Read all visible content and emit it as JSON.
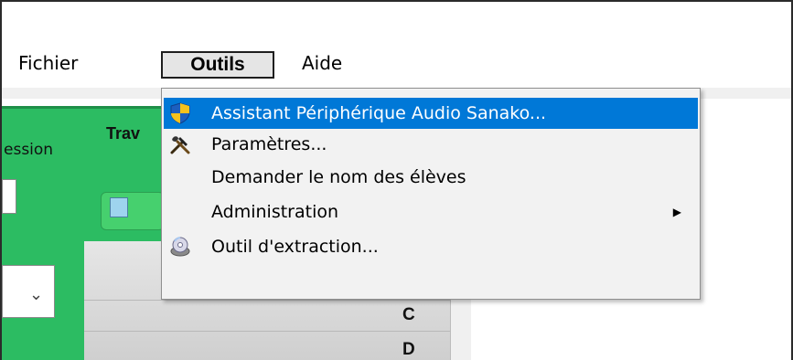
{
  "menubar": {
    "items": [
      {
        "label": "Fichier"
      },
      {
        "label": "Outils"
      },
      {
        "label": "Aide"
      }
    ]
  },
  "background": {
    "session_label": "ession",
    "panel_title": "Trav",
    "grid_rows": [
      "C",
      "D"
    ]
  },
  "dropdown": {
    "items": [
      {
        "label": "Assistant Périphérique Audio Sanako...",
        "icon": "shield-icon",
        "highlighted": true
      },
      {
        "label": "Paramètres...",
        "icon": "tools-icon"
      },
      {
        "label": "Demander le nom des élèves"
      },
      {
        "label": "Administration",
        "has_submenu": true
      },
      {
        "label": "Outil d'extraction...",
        "icon": "cd-icon"
      }
    ]
  },
  "colors": {
    "highlight": "#0078d7",
    "panel_green": "#2cbc62"
  }
}
